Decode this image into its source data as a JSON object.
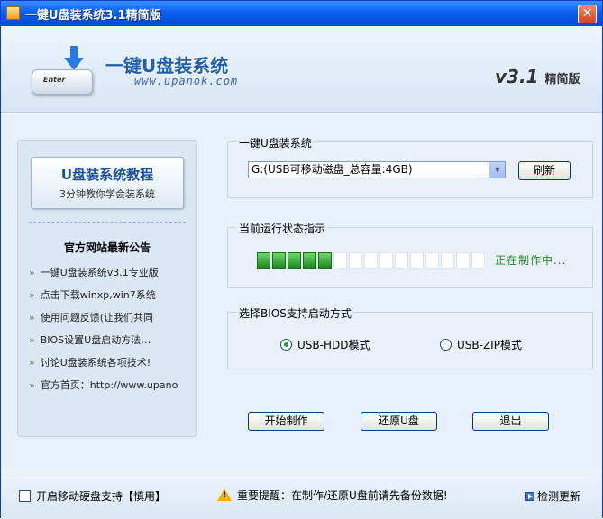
{
  "window": {
    "title": "一键U盘装系统3.1精简版",
    "close": "✕"
  },
  "header": {
    "key_label": "Enter",
    "brand": "一键U盘装系统",
    "url": "www.upanok.com",
    "version": "v3.1",
    "edition": "精简版"
  },
  "sidebar": {
    "tutorial_title": "U盘装系统教程",
    "tutorial_sub": "3分钟教你学会装系统",
    "news_title": "官方网站最新公告",
    "bullet": "»",
    "news": [
      "一键U盘装系统v3.1专业版",
      "点击下载winxp,win7系统",
      "使用问题反馈(让我们共同",
      "BIOS设置U盘启动方法…",
      "讨论U盘装系统各项技术!",
      "官方首页：http://www.upano"
    ]
  },
  "drive": {
    "label": "一键U盘装系统",
    "selected": "G:(USB可移动磁盘_总容量:4GB)",
    "refresh": "刷新"
  },
  "progress": {
    "label": "当前运行状态指示",
    "filled": 5,
    "total": 15,
    "status": "正在制作中..."
  },
  "bios": {
    "label": "选择BIOS支持启动方式",
    "hdd": "USB-HDD模式",
    "zip": "USB-ZIP模式",
    "selected": "USB-HDD模式"
  },
  "actions": {
    "start": "开始制作",
    "restore": "还原U盘",
    "exit": "退出"
  },
  "footer": {
    "checkbox": "开启移动硬盘支持【慎用】",
    "warning": "重要提醒：在制作/还原U盘前请先备份数据!",
    "update": "检测更新"
  },
  "colors": {
    "title_bar": "#0a5ef0",
    "progress_on": "#1c8a1c",
    "status_text": "#208a20",
    "brand": "#1e5fb0"
  }
}
